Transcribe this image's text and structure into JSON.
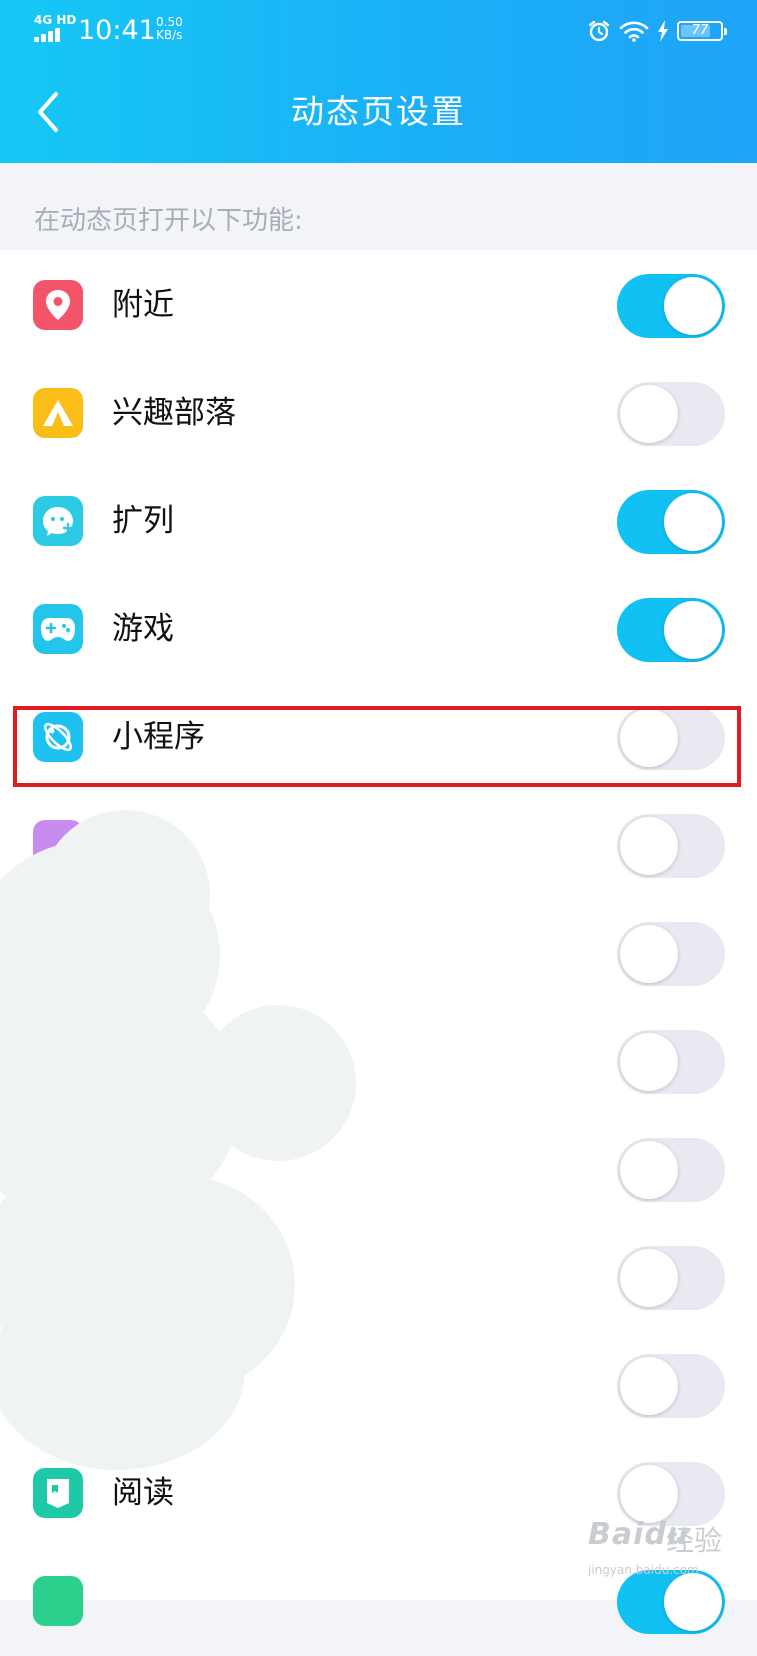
{
  "status_bar": {
    "network": "4G HD",
    "time": "10:41",
    "speed_value": "0.50",
    "speed_unit": "KB/s",
    "battery_percent": 77,
    "battery_label": "77"
  },
  "nav": {
    "title": "动态页设置"
  },
  "section_label": "在动态页打开以下功能:",
  "items": [
    {
      "label": "附近",
      "enabled": true,
      "icon": "location-pin-icon",
      "color": "#f2546a"
    },
    {
      "label": "兴趣部落",
      "enabled": false,
      "icon": "tent-icon",
      "color": "#fbbd17"
    },
    {
      "label": "扩列",
      "enabled": true,
      "icon": "face-plus-icon",
      "color": "#2ccbe3"
    },
    {
      "label": "游戏",
      "enabled": true,
      "icon": "gamepad-icon",
      "color": "#23c6ea"
    },
    {
      "label": "小程序",
      "enabled": false,
      "icon": "planet-icon",
      "color": "#1ec2f0"
    },
    {
      "label": "",
      "enabled": false,
      "icon": "",
      "color": "#c88cf0"
    },
    {
      "label": "",
      "enabled": false,
      "icon": "",
      "color": ""
    },
    {
      "label": "",
      "enabled": false,
      "icon": "",
      "color": ""
    },
    {
      "label": "",
      "enabled": false,
      "icon": "",
      "color": ""
    },
    {
      "label": "",
      "enabled": false,
      "icon": "",
      "color": ""
    },
    {
      "label": "",
      "enabled": false,
      "icon": "",
      "color": ""
    },
    {
      "label": "阅读",
      "enabled": false,
      "icon": "book-icon",
      "color": "#1ec9a8"
    },
    {
      "label": "",
      "enabled": true,
      "icon": "",
      "color": "#2bd08c"
    }
  ],
  "watermark": {
    "brand": "Baidu",
    "cn": "经验",
    "url": "jingyan.baidu.com"
  },
  "colors": {
    "header_gradient_start": "#16c8f5",
    "header_gradient_end": "#1fa4f7",
    "toggle_on": "#12c1f3",
    "toggle_off": "#e8e9f1",
    "highlight": "#e21a22"
  }
}
